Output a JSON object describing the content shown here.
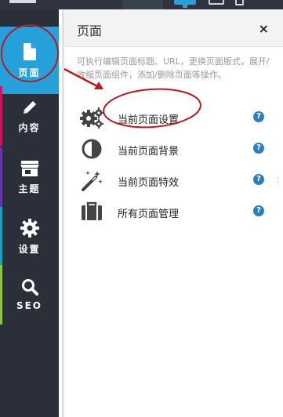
{
  "sidebar": {
    "items": [
      {
        "label": "页面",
        "icon": "file-icon",
        "active": true
      },
      {
        "label": "内容",
        "icon": "pencil-icon"
      },
      {
        "label": "主题",
        "icon": "store-icon"
      },
      {
        "label": "设置",
        "icon": "gear-icon"
      },
      {
        "label": "SEO",
        "icon": "search-icon"
      }
    ]
  },
  "panel": {
    "title": "页面",
    "close_label": "×",
    "description": "可执行编辑页面标题、URL，更换页面版式，展开/收缩页面组件，添加/删除页面等操作。",
    "menu": [
      {
        "label": "当前页面设置",
        "icon": "gears-icon",
        "help": "?"
      },
      {
        "label": "当前页面背景",
        "icon": "contrast-icon",
        "help": "?"
      },
      {
        "label": "当前页面特效",
        "icon": "magic-wand-icon",
        "help": "?"
      },
      {
        "label": "所有页面管理",
        "icon": "briefcase-icon",
        "help": "?"
      }
    ]
  },
  "colors": {
    "accent": "#25a0da",
    "annotation": "#c0171d",
    "help": "#2a7fc3"
  }
}
